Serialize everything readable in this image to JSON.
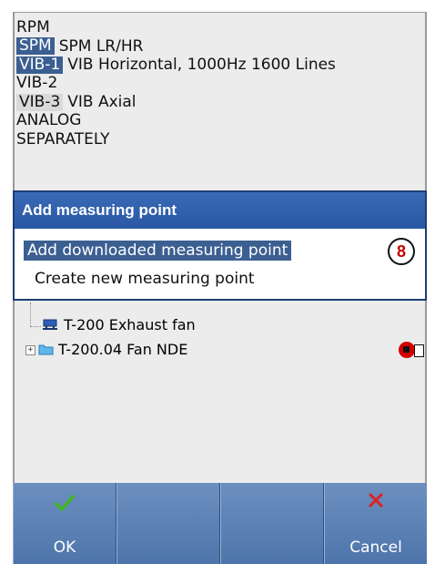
{
  "top_list": [
    {
      "tag": "RPM",
      "tag_style": "plain",
      "desc": ""
    },
    {
      "tag": "SPM",
      "tag_style": "blue",
      "desc": "SPM LR/HR"
    },
    {
      "tag": "VIB-1",
      "tag_style": "blue",
      "desc": "VIB Horizontal, 1000Hz 1600 Lines"
    },
    {
      "tag": "VIB-2",
      "tag_style": "plain",
      "desc": ""
    },
    {
      "tag": "VIB-3",
      "tag_style": "grey",
      "desc": "VIB Axial"
    },
    {
      "tag": "ANALOG",
      "tag_style": "plain",
      "desc": ""
    },
    {
      "tag": "SEPARATELY",
      "tag_style": "plain",
      "desc": ""
    }
  ],
  "dialog": {
    "title": "Add measuring point",
    "options": [
      "Add downloaded measuring point",
      "Create new measuring point"
    ],
    "callout": "8"
  },
  "tree": {
    "machine": "T-200  Exhaust fan",
    "point": "T-200.04 Fan NDE",
    "expander": "+"
  },
  "bottom_bar": {
    "ok_label": "OK",
    "cancel_label": "Cancel"
  },
  "colors": {
    "title_bar": "#2a57a3",
    "selection": "#3c5f92",
    "bottom_bar": "#5a80b4",
    "check": "#3fb61e",
    "cross": "#e02020",
    "callout_digit": "#c00000"
  }
}
